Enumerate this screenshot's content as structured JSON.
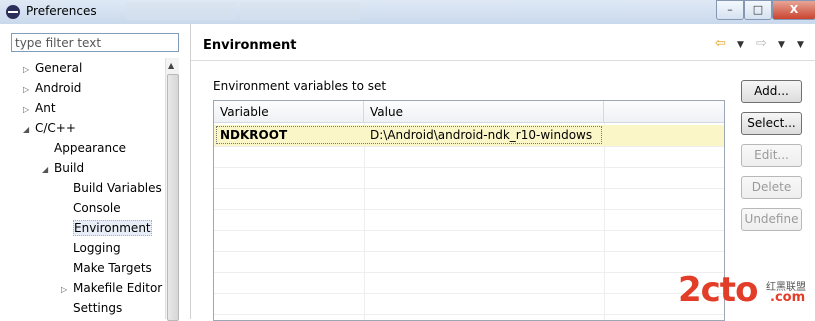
{
  "window": {
    "title": "Preferences",
    "controls": {
      "minimize": "–",
      "maximize": "□",
      "close": "X"
    }
  },
  "filter": {
    "placeholder": "type filter text"
  },
  "tree": [
    {
      "label": "General",
      "level": 0,
      "arrow": "right"
    },
    {
      "label": "Android",
      "level": 0,
      "arrow": "right"
    },
    {
      "label": "Ant",
      "level": 0,
      "arrow": "right"
    },
    {
      "label": "C/C++",
      "level": 0,
      "arrow": "down"
    },
    {
      "label": "Appearance",
      "level": 1,
      "arrow": "none"
    },
    {
      "label": "Build",
      "level": 1,
      "arrow": "down"
    },
    {
      "label": "Build Variables",
      "level": 2,
      "arrow": "none"
    },
    {
      "label": "Console",
      "level": 2,
      "arrow": "none"
    },
    {
      "label": "Environment",
      "level": 2,
      "arrow": "none",
      "selected": true
    },
    {
      "label": "Logging",
      "level": 2,
      "arrow": "none"
    },
    {
      "label": "Make Targets",
      "level": 2,
      "arrow": "none"
    },
    {
      "label": "Makefile Editor",
      "level": 2,
      "arrow": "right"
    },
    {
      "label": "Settings",
      "level": 2,
      "arrow": "none"
    }
  ],
  "page": {
    "title": "Environment",
    "section_label": "Environment variables to set"
  },
  "table": {
    "columns": [
      "Variable",
      "Value"
    ],
    "rows": [
      {
        "variable": "NDKROOT",
        "value": "D:\\Android\\android-ndk_r10-windows",
        "selected": true
      }
    ]
  },
  "buttons": {
    "add": "Add...",
    "select": "Select...",
    "edit": "Edit...",
    "delete": "Delete",
    "undefine": "Undefine"
  },
  "watermark": {
    "logo": "2cto",
    "site": "红黑联盟",
    "suffix": ".com"
  },
  "colors": {
    "selection_row": "#fbf6c8",
    "nav_arrow": "#e0a020"
  }
}
